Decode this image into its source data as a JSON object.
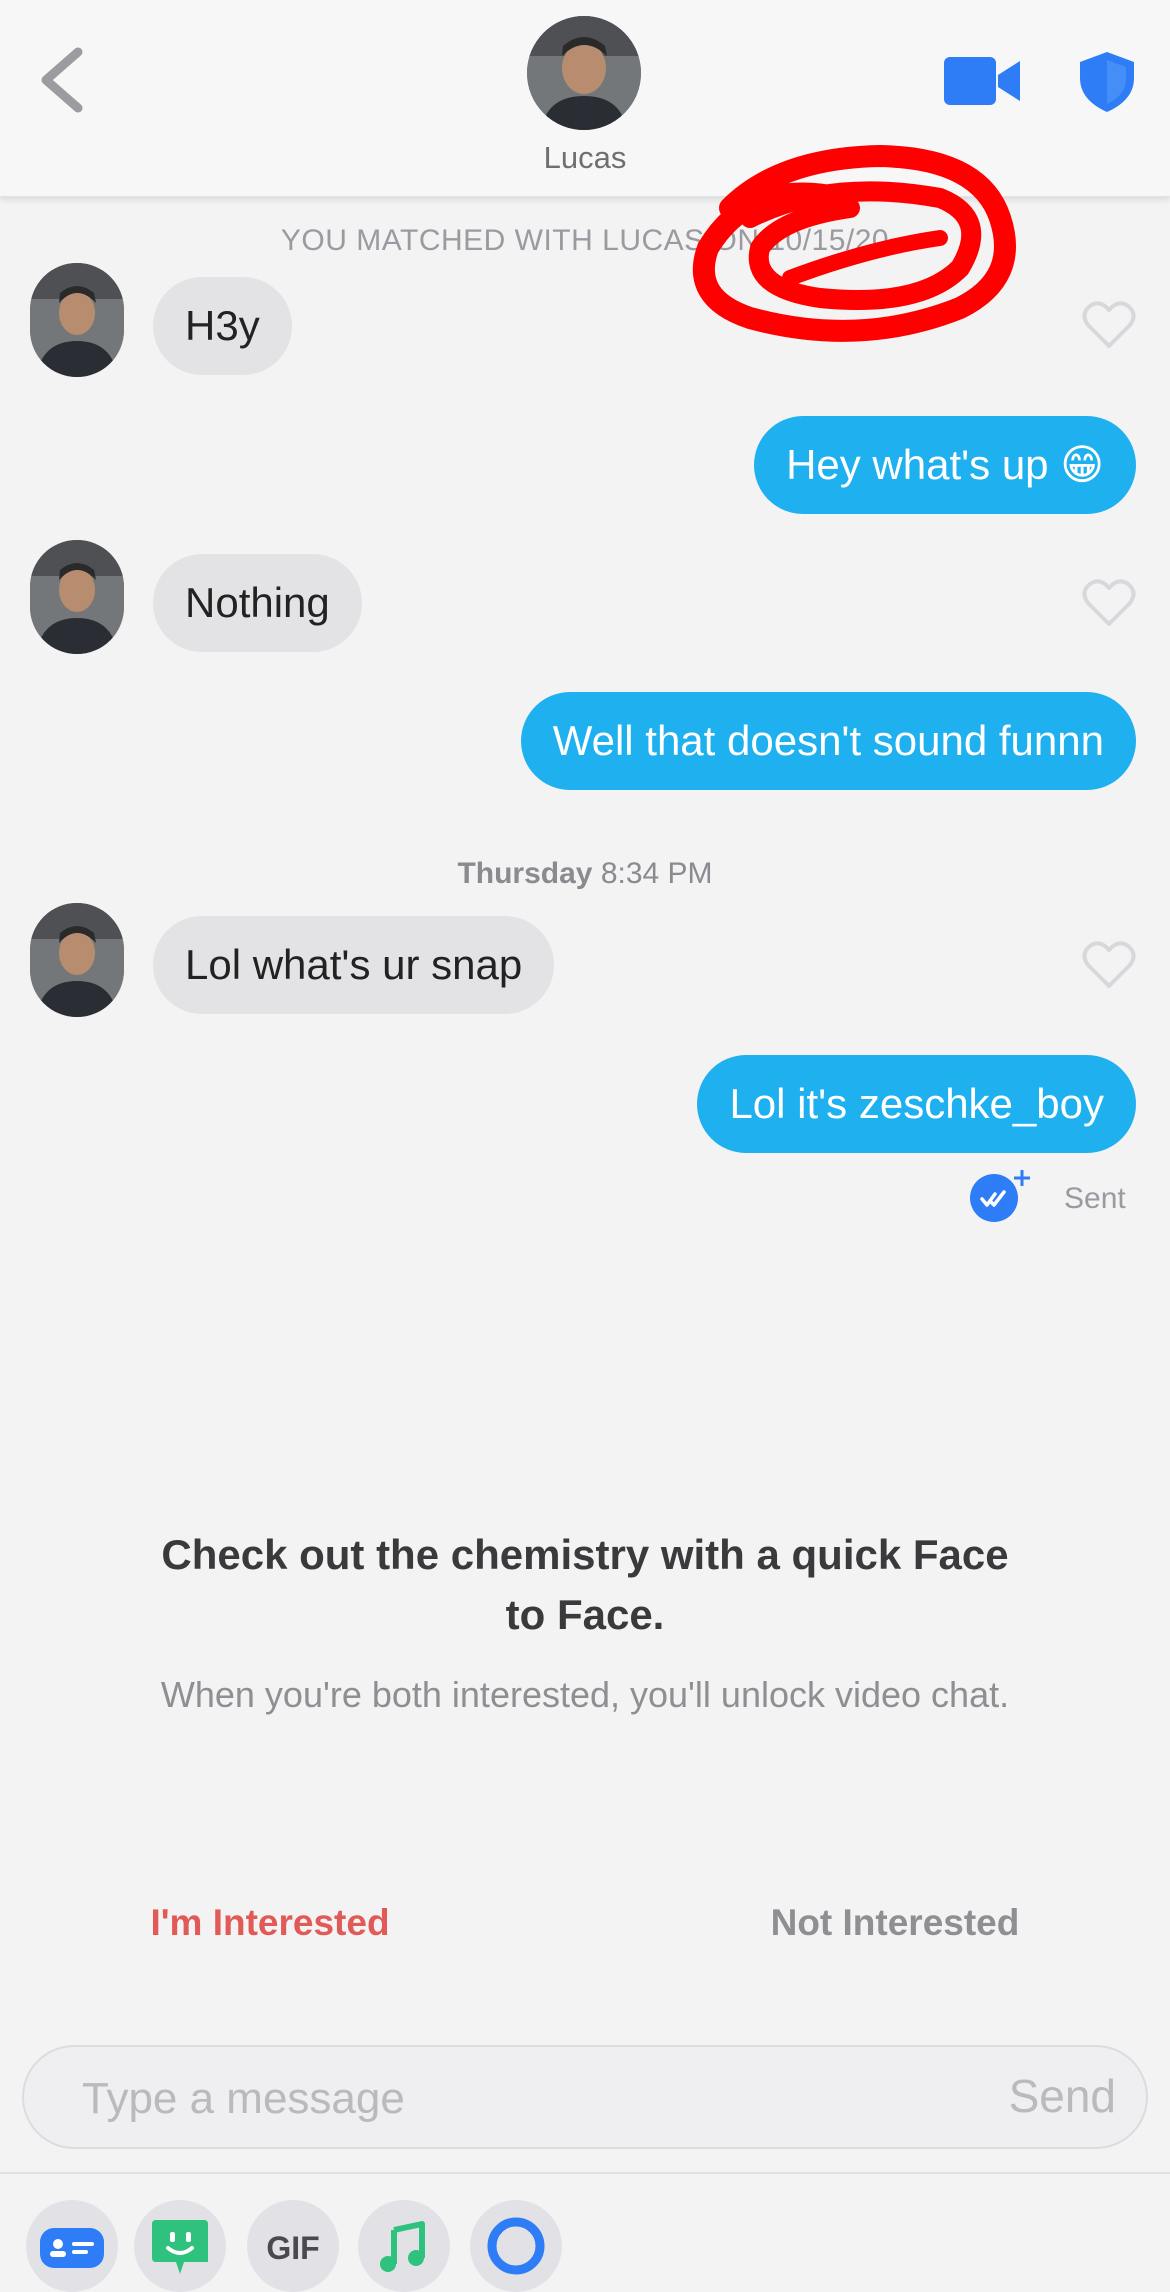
{
  "header": {
    "contact_name": "Lucas"
  },
  "match_banner": {
    "text": "YOU MATCHED WITH LUCAS ON 10/15/20"
  },
  "messages": [
    {
      "direction": "incoming",
      "text": "H3y"
    },
    {
      "direction": "outgoing",
      "text": "Hey what's up 😁"
    },
    {
      "direction": "incoming",
      "text": "Nothing"
    },
    {
      "direction": "outgoing",
      "text": "Well that doesn't sound funnn"
    },
    {
      "direction": "incoming",
      "text": "Lol what's ur snap"
    },
    {
      "direction": "outgoing",
      "text": "Lol it's zeschke_boy"
    }
  ],
  "day_stamp": {
    "day": "Thursday",
    "time": "8:34 PM"
  },
  "delivery_status": "Sent",
  "face_to_face": {
    "title": "Check out the chemistry with a quick Face to Face.",
    "subtitle": "When you're both interested, you'll unlock video chat.",
    "interested_label": "I'm Interested",
    "not_interested_label": "Not Interested"
  },
  "composer": {
    "placeholder": "Type a message",
    "send_label": "Send"
  },
  "toolbar": {
    "gif_label": "GIF"
  },
  "colors": {
    "outgoing_bubble": "#1fb0ef",
    "incoming_bubble": "#e3e3e6",
    "accent_blue": "#2e7cf6",
    "interested_red": "#e25a57",
    "scribble_red": "#ff0000"
  },
  "icons": [
    "back-chevron-icon",
    "video-camera-icon",
    "shield-icon",
    "heart-icon",
    "read-receipt-icon",
    "contact-card-icon",
    "sticker-icon",
    "gif-icon",
    "music-note-icon",
    "loop-icon"
  ]
}
